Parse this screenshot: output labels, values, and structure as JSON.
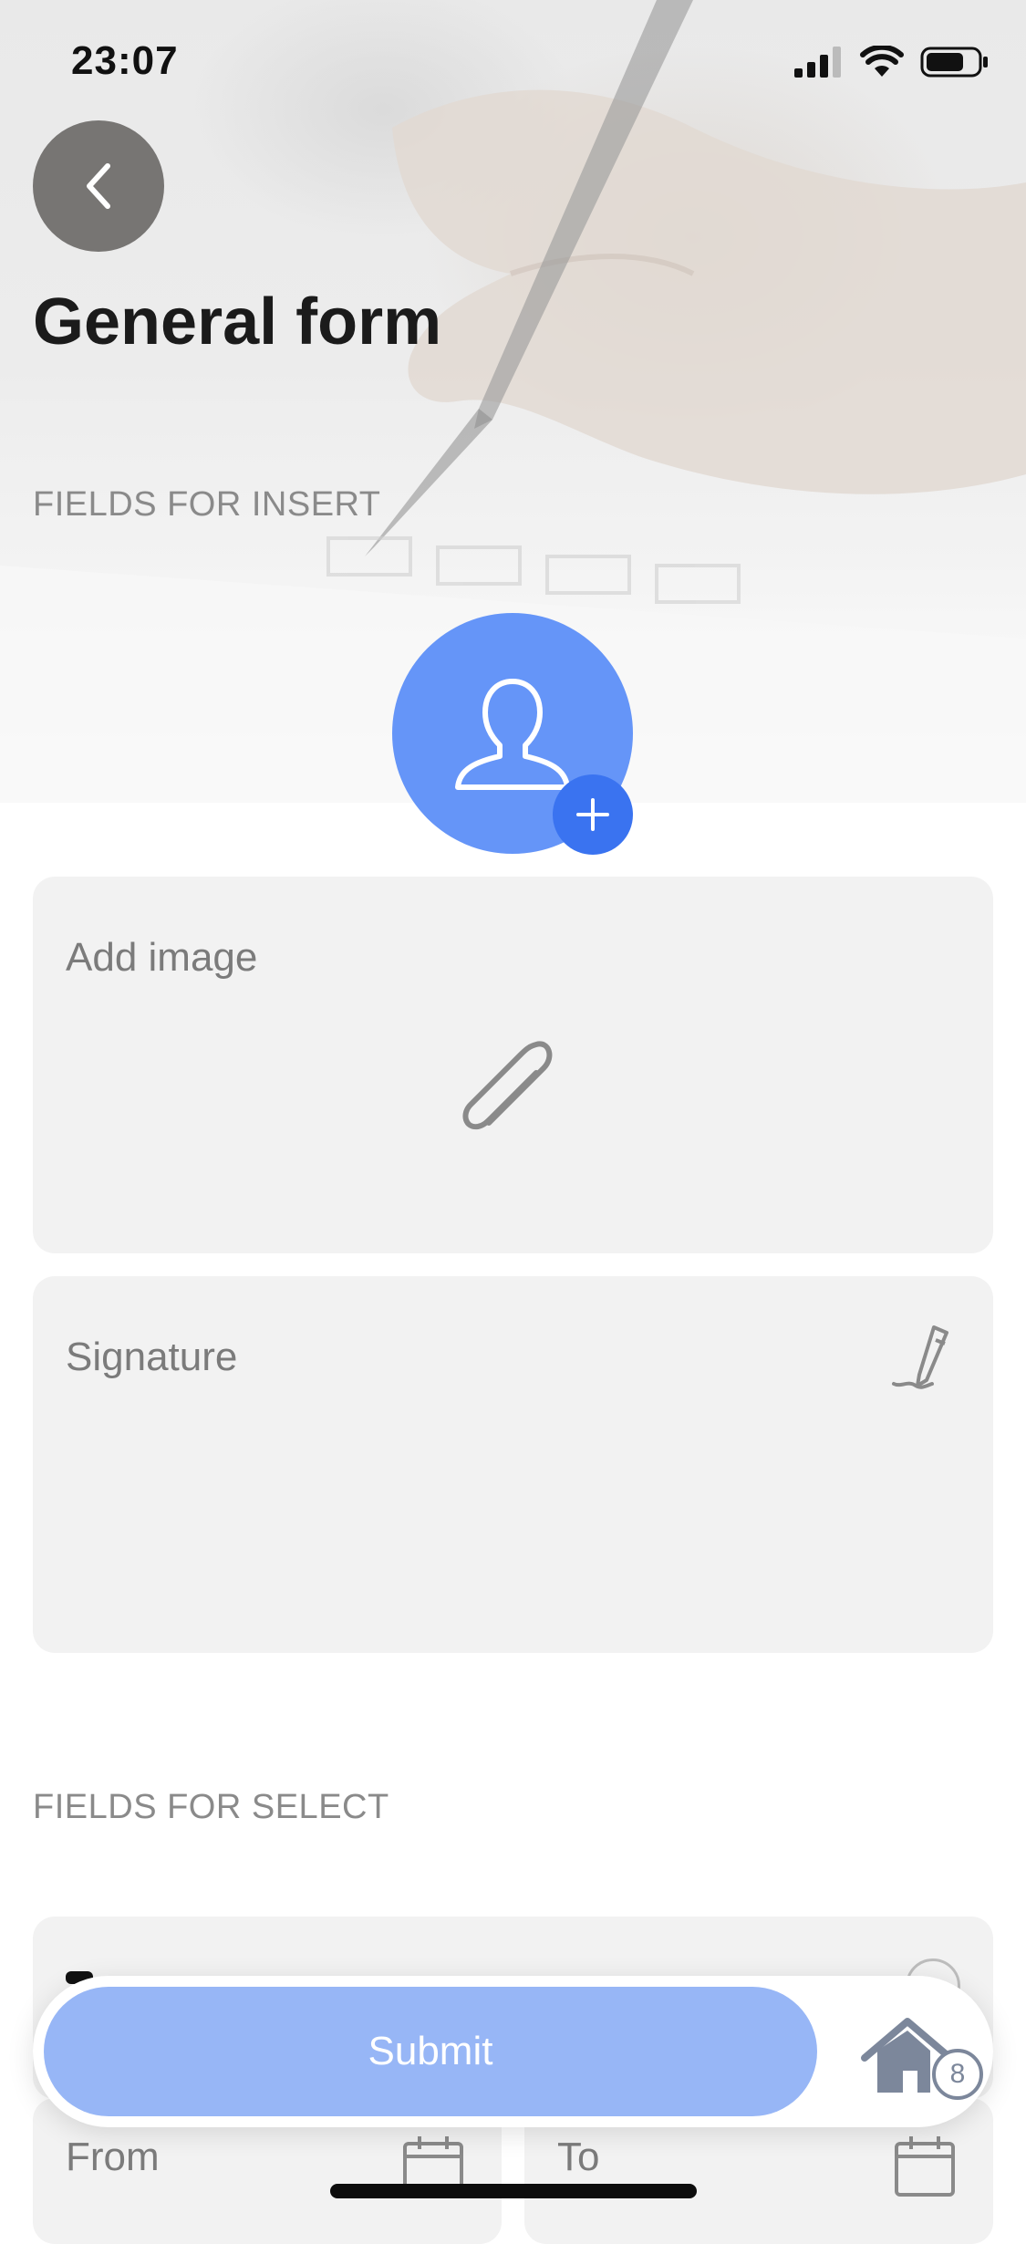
{
  "status_bar": {
    "time": "23:07"
  },
  "header": {
    "title": "General form"
  },
  "sections": {
    "insert_label": "FIELDS FOR INSERT",
    "select_label": "FIELDS FOR SELECT"
  },
  "fields": {
    "add_image_label": "Add image",
    "signature_label": "Signature",
    "from_label": "From",
    "to_label": "To"
  },
  "actions": {
    "submit_label": "Submit",
    "home_badge_count": "8"
  },
  "icons": {
    "back": "chevron-left-icon",
    "avatar": "user-icon",
    "add": "plus-icon",
    "attach": "paperclip-icon",
    "signature": "pen-icon",
    "calendar": "calendar-icon",
    "home": "home-icon"
  },
  "colors": {
    "accent": "#6595f8",
    "accent_dark": "#3a73f0",
    "submit_bg": "#97b6f6",
    "card_bg": "#f2f2f2"
  }
}
